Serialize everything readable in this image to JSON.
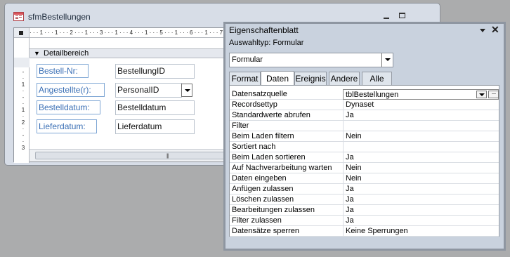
{
  "form_window": {
    "title": "sfmBestellungen",
    "ruler_marks": "· · · 1 · · · 1 · · · 2 · · · 1 · · · 3 · · · 1 · · · 4 · · · 1 · · · 5 · · · 1 · · · 6 · · · 1 · · · 7 · · · 1 · · · 8 · · · 1 · · · 9 · · · 1 ·",
    "vruler_marks": "-\n·\n1\n·\n-\n·\n1\n·\n2\n·\n-\n·\n3",
    "section_label": "Detailbereich",
    "labels": [
      "Bestell-Nr:",
      "Angestellte(r):",
      "Bestelldatum:",
      "Lieferdatum:"
    ],
    "fields": [
      "BestellungID",
      "PersonalID",
      "Bestelldatum",
      "Lieferdatum"
    ]
  },
  "property_sheet": {
    "title": "Eigenschaftenblatt",
    "selection_type_label": "Auswahltyp:  Formular",
    "object_combo_value": "Formular",
    "tabs": [
      "Format",
      "Daten",
      "Ereignis",
      "Andere",
      "Alle"
    ],
    "active_tab": "Daten",
    "properties": [
      {
        "name": "Datensatzquelle",
        "value": "tblBestellungen"
      },
      {
        "name": "Recordsettyp",
        "value": "Dynaset"
      },
      {
        "name": "Standardwerte abrufen",
        "value": "Ja"
      },
      {
        "name": "Filter",
        "value": ""
      },
      {
        "name": "Beim Laden filtern",
        "value": "Nein"
      },
      {
        "name": "Sortiert nach",
        "value": ""
      },
      {
        "name": "Beim Laden sortieren",
        "value": "Ja"
      },
      {
        "name": "Auf Nachverarbeitung warten",
        "value": "Nein"
      },
      {
        "name": "Daten eingeben",
        "value": "Nein"
      },
      {
        "name": "Anfügen zulassen",
        "value": "Ja"
      },
      {
        "name": "Löschen zulassen",
        "value": "Ja"
      },
      {
        "name": "Bearbeitungen zulassen",
        "value": "Ja"
      },
      {
        "name": "Filter zulassen",
        "value": "Ja"
      },
      {
        "name": "Datensätze sperren",
        "value": "Keine Sperrungen"
      }
    ]
  }
}
